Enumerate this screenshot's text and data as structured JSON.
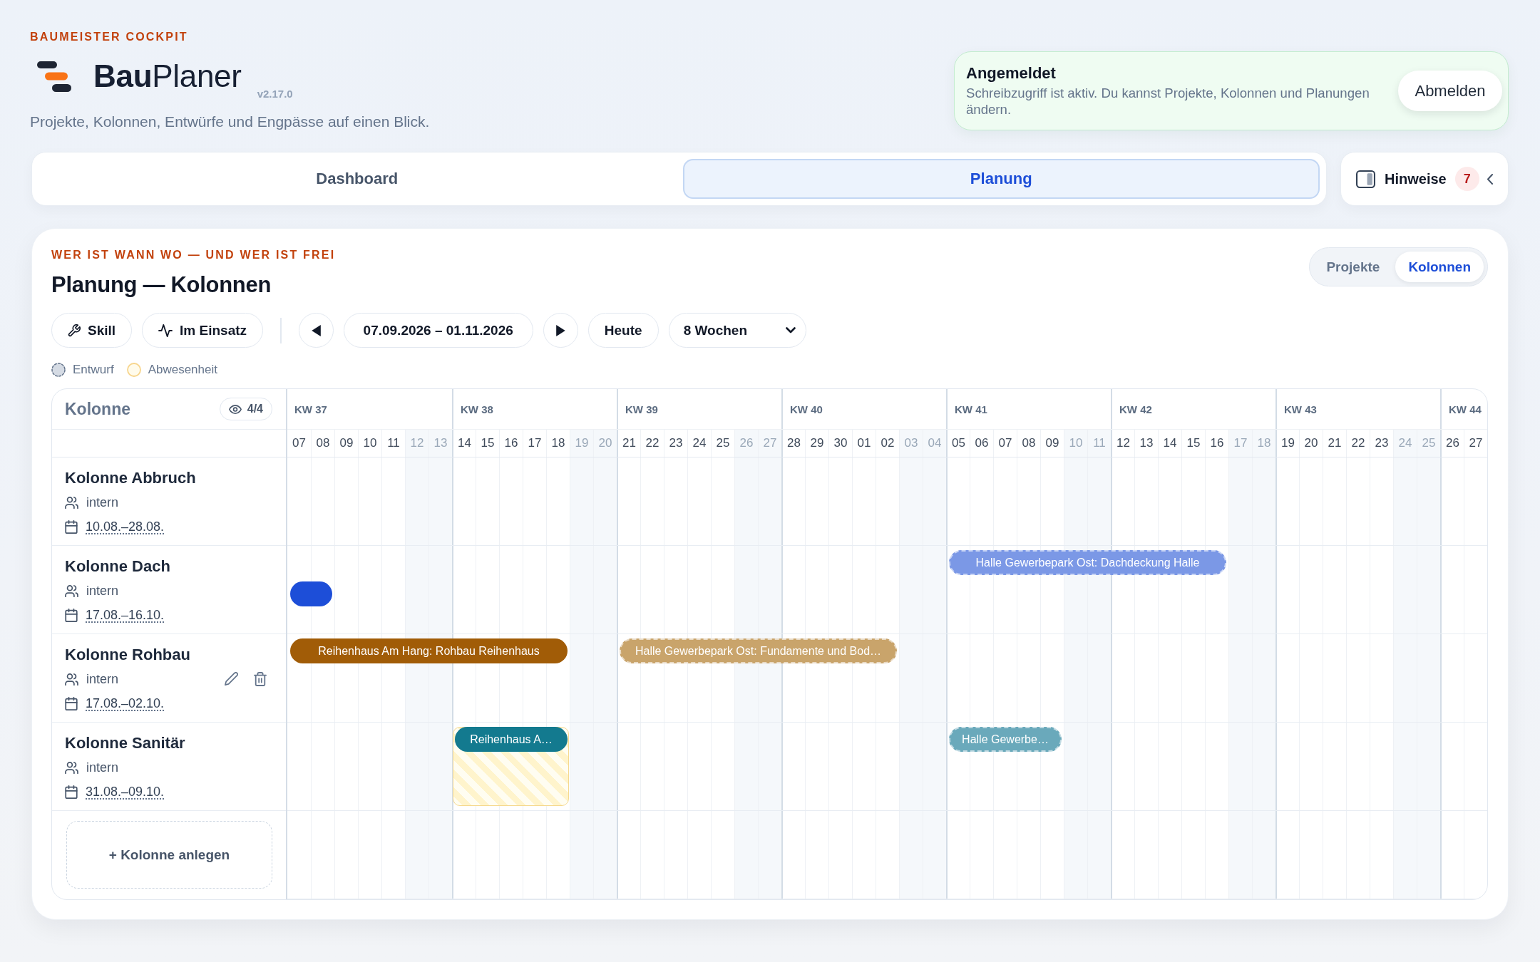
{
  "header": {
    "eyebrow": "BAUMEISTER COCKPIT",
    "brand": "**Bau**Planer",
    "version": "v2.17.0",
    "tagline": "Projekte, Kolonnen, Entwürfe und Engpässe auf einen Blick."
  },
  "session": {
    "title": "Angemeldet",
    "message": "Schreibzugriff ist aktiv. Du kannst Projekte, Kolonnen und Planungen ändern.",
    "button": "Abmelden"
  },
  "tabs": [
    {
      "label": "Dashboard",
      "selected": false
    },
    {
      "label": "Planung",
      "selected": true
    }
  ],
  "hints": {
    "label": "Hinweise",
    "count": "7"
  },
  "planning": {
    "eyebrow": "WER IST WANN WO — UND WER IST FREI",
    "title": "Planung — Kolonnen",
    "views": [
      {
        "label": "Projekte",
        "selected": false
      },
      {
        "label": "Kolonnen",
        "selected": true
      }
    ],
    "toolbar": {
      "filters": [
        {
          "label": "Skill"
        },
        {
          "label": "Im Einsatz"
        }
      ],
      "date_range": "07.09.2026 – 01.11.2026",
      "today": "Heute",
      "period": "8 Wochen"
    },
    "legend": [
      {
        "kind": "draft",
        "label": "Entwurf"
      },
      {
        "kind": "absence",
        "label": "Abwesenheit"
      }
    ]
  },
  "gantt": {
    "column_header": "Kolonne",
    "visible_count": "4/4",
    "weeks": [
      {
        "label": "KW 37",
        "days": [
          {
            "label": "07",
            "weekend": false
          },
          {
            "label": "08",
            "weekend": false
          },
          {
            "label": "09",
            "weekend": false
          },
          {
            "label": "10",
            "weekend": false
          },
          {
            "label": "11",
            "weekend": false
          },
          {
            "label": "12",
            "weekend": true
          },
          {
            "label": "13",
            "weekend": true
          }
        ]
      },
      {
        "label": "KW 38",
        "days": [
          {
            "label": "14",
            "weekend": false
          },
          {
            "label": "15",
            "weekend": false
          },
          {
            "label": "16",
            "weekend": false
          },
          {
            "label": "17",
            "weekend": false
          },
          {
            "label": "18",
            "weekend": false
          },
          {
            "label": "19",
            "weekend": true
          },
          {
            "label": "20",
            "weekend": true
          }
        ]
      },
      {
        "label": "KW 39",
        "days": [
          {
            "label": "21",
            "weekend": false
          },
          {
            "label": "22",
            "weekend": false
          },
          {
            "label": "23",
            "weekend": false
          },
          {
            "label": "24",
            "weekend": false
          },
          {
            "label": "25",
            "weekend": false
          },
          {
            "label": "26",
            "weekend": true
          },
          {
            "label": "27",
            "weekend": true
          }
        ]
      },
      {
        "label": "KW 40",
        "days": [
          {
            "label": "28",
            "weekend": false
          },
          {
            "label": "29",
            "weekend": false
          },
          {
            "label": "30",
            "weekend": false
          },
          {
            "label": "01",
            "weekend": false
          },
          {
            "label": "02",
            "weekend": false
          },
          {
            "label": "03",
            "weekend": true
          },
          {
            "label": "04",
            "weekend": true
          }
        ]
      },
      {
        "label": "KW 41",
        "days": [
          {
            "label": "05",
            "weekend": false
          },
          {
            "label": "06",
            "weekend": false
          },
          {
            "label": "07",
            "weekend": false
          },
          {
            "label": "08",
            "weekend": false
          },
          {
            "label": "09",
            "weekend": false
          },
          {
            "label": "10",
            "weekend": true
          },
          {
            "label": "11",
            "weekend": true
          }
        ]
      },
      {
        "label": "KW 42",
        "days": [
          {
            "label": "12",
            "weekend": false
          },
          {
            "label": "13",
            "weekend": false
          },
          {
            "label": "14",
            "weekend": false
          },
          {
            "label": "15",
            "weekend": false
          },
          {
            "label": "16",
            "weekend": false
          },
          {
            "label": "17",
            "weekend": true
          },
          {
            "label": "18",
            "weekend": true
          }
        ]
      },
      {
        "label": "KW 43",
        "days": [
          {
            "label": "19",
            "weekend": false
          },
          {
            "label": "20",
            "weekend": false
          },
          {
            "label": "21",
            "weekend": false
          },
          {
            "label": "22",
            "weekend": false
          },
          {
            "label": "23",
            "weekend": false
          },
          {
            "label": "24",
            "weekend": true
          },
          {
            "label": "25",
            "weekend": true
          }
        ]
      },
      {
        "label": "KW 44",
        "days": [
          {
            "label": "26",
            "weekend": false
          },
          {
            "label": "27",
            "weekend": false
          }
        ]
      }
    ],
    "rows": [
      {
        "name": "Kolonne Abbruch",
        "type": "intern",
        "period": "10.08.–28.08.",
        "show_actions": false
      },
      {
        "name": "Kolonne Dach",
        "type": "intern",
        "period": "17.08.–16.10.",
        "show_actions": false,
        "lanes": [
          [
            {
              "kind": "empty"
            },
            {
              "kind": "empty"
            },
            {
              "kind": "empty"
            },
            {
              "kind": "empty"
            },
            {
              "kind": "empty"
            },
            {
              "kind": "empty"
            },
            {
              "kind": "empty"
            },
            {
              "kind": "empty"
            },
            {
              "kind": "empty"
            },
            {
              "kind": "empty"
            },
            {
              "kind": "empty"
            },
            {
              "kind": "empty"
            },
            {
              "kind": "empty"
            },
            {
              "kind": "empty"
            },
            {
              "kind": "empty"
            },
            {
              "kind": "empty"
            },
            {
              "kind": "empty"
            },
            {
              "kind": "empty"
            },
            {
              "kind": "empty"
            },
            {
              "kind": "empty"
            },
            {
              "kind": "empty"
            },
            {
              "kind": "empty"
            },
            {
              "kind": "empty"
            },
            {
              "kind": "empty"
            },
            {
              "kind": "empty"
            },
            {
              "kind": "empty"
            },
            {
              "kind": "empty"
            },
            {
              "kind": "empty"
            },
            {
              "kind": "draft",
              "label": "Halle Gewerbepark Ost: Dachdeckung Halle",
              "color": "#7b98e6"
            },
            {
              "kind": "continued"
            },
            {
              "kind": "continued"
            },
            {
              "kind": "continued"
            },
            {
              "kind": "continued"
            },
            {
              "kind": "continued"
            },
            {
              "kind": "continued"
            },
            {
              "kind": "continued"
            },
            {
              "kind": "continued"
            },
            {
              "kind": "continued"
            },
            {
              "kind": "continued"
            },
            {
              "kind": "continued"
            }
          ],
          [
            {
              "kind": "confirmed",
              "color": "#1d4ed8"
            },
            {
              "kind": "continued"
            }
          ]
        ]
      },
      {
        "name": "Kolonne Rohbau",
        "type": "intern",
        "period": "17.08.–02.10.",
        "show_actions": true,
        "lanes": [
          [
            {
              "kind": "confirmed",
              "label": "Reihenhaus Am Hang: Rohbau Reihenhaus",
              "color": "#a15c07"
            },
            {
              "kind": "continued"
            },
            {
              "kind": "continued"
            },
            {
              "kind": "continued"
            },
            {
              "kind": "continued"
            },
            {
              "kind": "continued"
            },
            {
              "kind": "continued"
            },
            {
              "kind": "continued"
            },
            {
              "kind": "continued"
            },
            {
              "kind": "continued"
            },
            {
              "kind": "continued"
            },
            {
              "kind": "continued"
            },
            {
              "kind": "empty"
            },
            {
              "kind": "empty"
            },
            {
              "kind": "draft",
              "label": "Halle Gewerbepark Ost: Fundamente und Bod…",
              "color": "#c9a46b"
            },
            {
              "kind": "continued"
            },
            {
              "kind": "continued"
            },
            {
              "kind": "continued"
            },
            {
              "kind": "continued"
            },
            {
              "kind": "continued"
            },
            {
              "kind": "continued"
            },
            {
              "kind": "continued"
            },
            {
              "kind": "continued"
            },
            {
              "kind": "continued"
            },
            {
              "kind": "continued"
            },
            {
              "kind": "continued"
            }
          ]
        ]
      },
      {
        "name": "Kolonne Sanitär",
        "type": "intern",
        "period": "31.08.–09.10.",
        "show_actions": false,
        "absences": [
          {
            "kind": "empty"
          },
          {
            "kind": "empty"
          },
          {
            "kind": "empty"
          },
          {
            "kind": "empty"
          },
          {
            "kind": "empty"
          },
          {
            "kind": "empty"
          },
          {
            "kind": "empty"
          },
          {
            "kind": "absence"
          },
          {
            "kind": "continued"
          },
          {
            "kind": "continued"
          },
          {
            "kind": "continued"
          },
          {
            "kind": "continued"
          }
        ],
        "lanes": [
          [
            {
              "kind": "empty"
            },
            {
              "kind": "empty"
            },
            {
              "kind": "empty"
            },
            {
              "kind": "empty"
            },
            {
              "kind": "empty"
            },
            {
              "kind": "empty"
            },
            {
              "kind": "empty"
            },
            {
              "kind": "confirmed",
              "label": "Reihenhaus A…",
              "color": "#137a8f"
            },
            {
              "kind": "continued"
            },
            {
              "kind": "continued"
            },
            {
              "kind": "continued"
            },
            {
              "kind": "continued"
            },
            {
              "kind": "empty"
            },
            {
              "kind": "empty"
            },
            {
              "kind": "empty"
            },
            {
              "kind": "empty"
            },
            {
              "kind": "empty"
            },
            {
              "kind": "empty"
            },
            {
              "kind": "empty"
            },
            {
              "kind": "empty"
            },
            {
              "kind": "empty"
            },
            {
              "kind": "empty"
            },
            {
              "kind": "empty"
            },
            {
              "kind": "empty"
            },
            {
              "kind": "empty"
            },
            {
              "kind": "empty"
            },
            {
              "kind": "empty"
            },
            {
              "kind": "empty"
            },
            {
              "kind": "draft",
              "label": "Halle Gewerbe…",
              "color": "#6aa9bb"
            },
            {
              "kind": "continued"
            },
            {
              "kind": "continued"
            },
            {
              "kind": "continued"
            },
            {
              "kind": "continued"
            }
          ]
        ]
      }
    ],
    "add_button": "+ Kolonne anlegen"
  }
}
